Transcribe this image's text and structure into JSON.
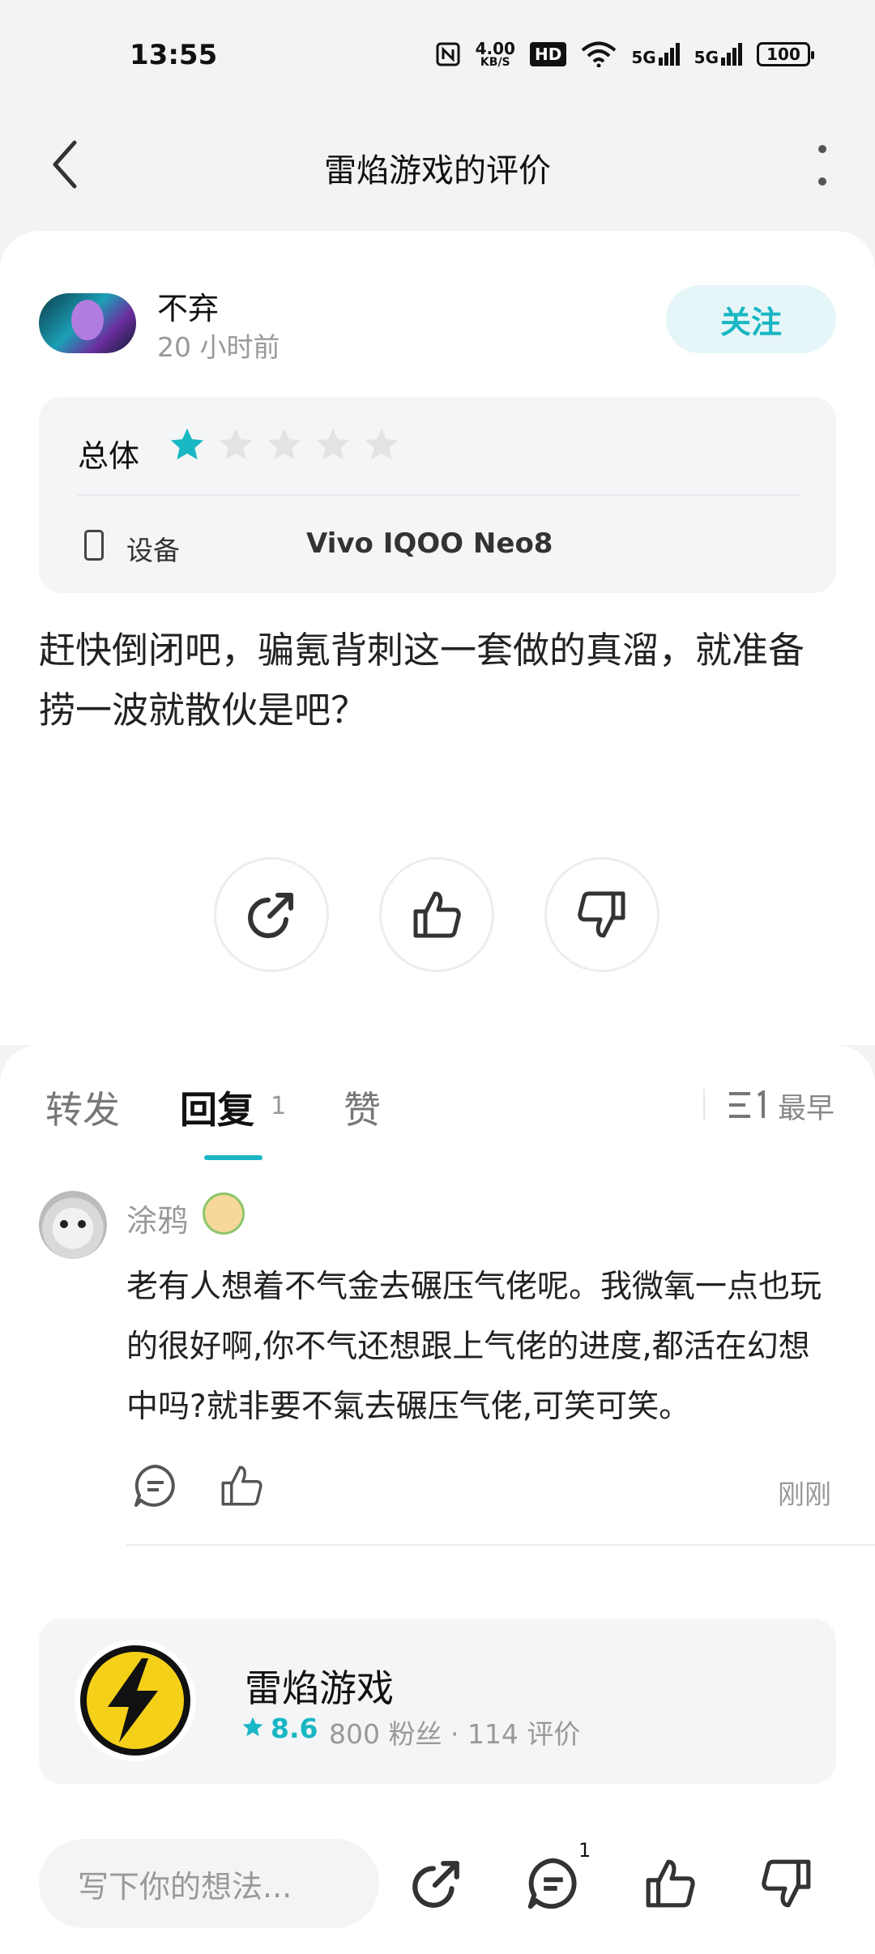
{
  "status_bar": {
    "time": "13:55",
    "net_speed_top": "4.00",
    "net_speed_bottom": "KB/S",
    "hd_label": "HD",
    "signal1": "5G",
    "signal2": "5G",
    "battery": "100"
  },
  "nav": {
    "title": "雷焰游戏的评价",
    "back_icon": "chevron-left-icon",
    "more_icon": "more-vertical-icon"
  },
  "review": {
    "author": "不弃",
    "time": "20 小时前",
    "follow_label": "关注",
    "overall_label": "总体",
    "rating": 1,
    "rating_max": 5,
    "device_label": "设备",
    "device_value": "Vivo IQOO Neo8",
    "text": "赶快倒闭吧，骗氪背刺这一套做的真溜，就准备捞一波就散伙是吧？",
    "actions": [
      "share-icon",
      "thumbs-up-icon",
      "thumbs-down-icon"
    ]
  },
  "tabs": [
    {
      "label": "转发",
      "active": false
    },
    {
      "label": "回复",
      "count": "1",
      "active": true
    },
    {
      "label": "赞",
      "active": false
    }
  ],
  "sort": {
    "icon": "sort-list-icon",
    "label": "最早"
  },
  "comments": [
    {
      "author": "涂鸦",
      "text": "老有人想着不气金去碾压气佬呢。我微氧一点也玩的很好啊,你不气还想跟上气佬的进度,都活在幻想中吗?就非要不氣去碾压气佬,可笑可笑。",
      "time": "刚刚"
    }
  ],
  "game": {
    "name": "雷焰游戏",
    "score": "8.6",
    "stats": "800 粉丝 · 114 评价"
  },
  "bottom_bar": {
    "input_placeholder": "写下你的想法...",
    "comment_badge": "1"
  },
  "colors": {
    "accent": "#19b6c3",
    "star_empty": "#e3e3e3"
  }
}
